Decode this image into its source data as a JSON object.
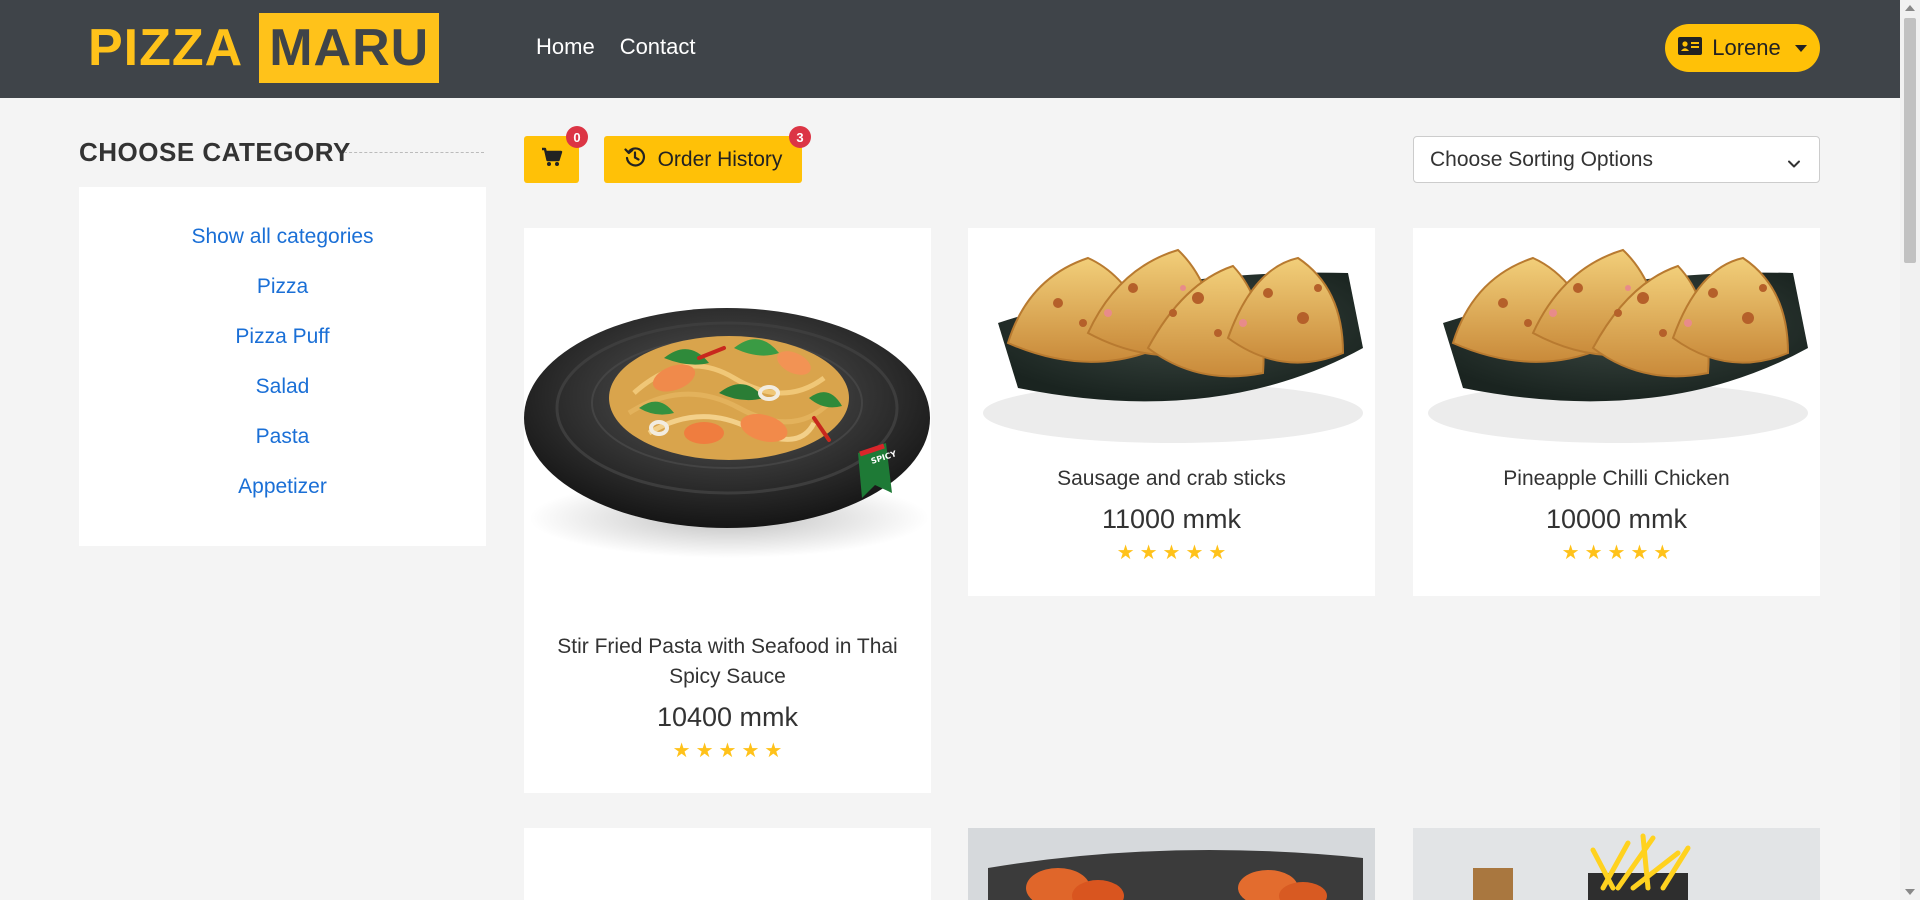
{
  "navbar": {
    "logo_part1": "PIZZA",
    "logo_part2": "MARU",
    "links": [
      "Home",
      "Contact"
    ],
    "user_name": "Lorene"
  },
  "sidebar": {
    "heading": "CHOOSE CATEGORY",
    "categories": [
      "Show all categories",
      "Pizza",
      "Pizza Puff",
      "Salad",
      "Pasta",
      "Appetizer"
    ]
  },
  "toolbar": {
    "cart_count": "0",
    "order_history_label": "Order History",
    "order_history_count": "3",
    "sort_placeholder": "Choose Sorting Options"
  },
  "products": [
    {
      "name": "Stir Fried Pasta with Seafood in Thai Spicy Sauce",
      "price": "10400 mmk",
      "rating": 5,
      "image_badge": "SPICY"
    },
    {
      "name": "Sausage and crab sticks",
      "price": "11000 mmk",
      "rating": 5
    },
    {
      "name": "Pineapple Chilli Chicken",
      "price": "10000 mmk",
      "rating": 5
    }
  ],
  "colors": {
    "navbar_bg": "#3f4449",
    "accent_yellow": "#ffc107",
    "link_blue": "#1a6fd6",
    "badge_red": "#dc3545",
    "page_bg": "#f4f4f4"
  },
  "icons": [
    "cart-icon",
    "history-icon",
    "id-card-icon",
    "chevron-down-icon",
    "star-icon"
  ]
}
